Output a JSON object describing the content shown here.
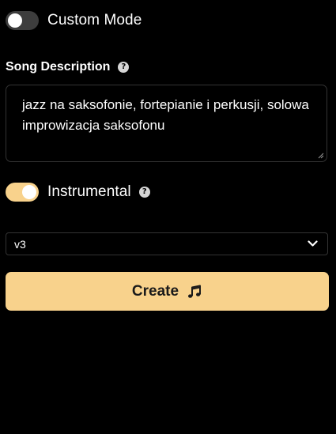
{
  "custom_mode": {
    "label": "Custom Mode",
    "enabled": false
  },
  "song_description": {
    "label": "Song Description",
    "help_icon": "question-circle-icon",
    "value": "jazz na saksofonie, fortepianie i perkusji, solowa improwizacja saksofonu"
  },
  "instrumental": {
    "label": "Instrumental",
    "enabled": true,
    "help_icon": "question-circle-icon"
  },
  "model_select": {
    "selected": "v3",
    "icon": "chevron-down-icon"
  },
  "create_button": {
    "label": "Create",
    "icon": "music-note-icon"
  },
  "colors": {
    "background": "#000000",
    "accent": "#f8d28c",
    "toggle_off": "#3d3d3d",
    "border": "#333333"
  }
}
